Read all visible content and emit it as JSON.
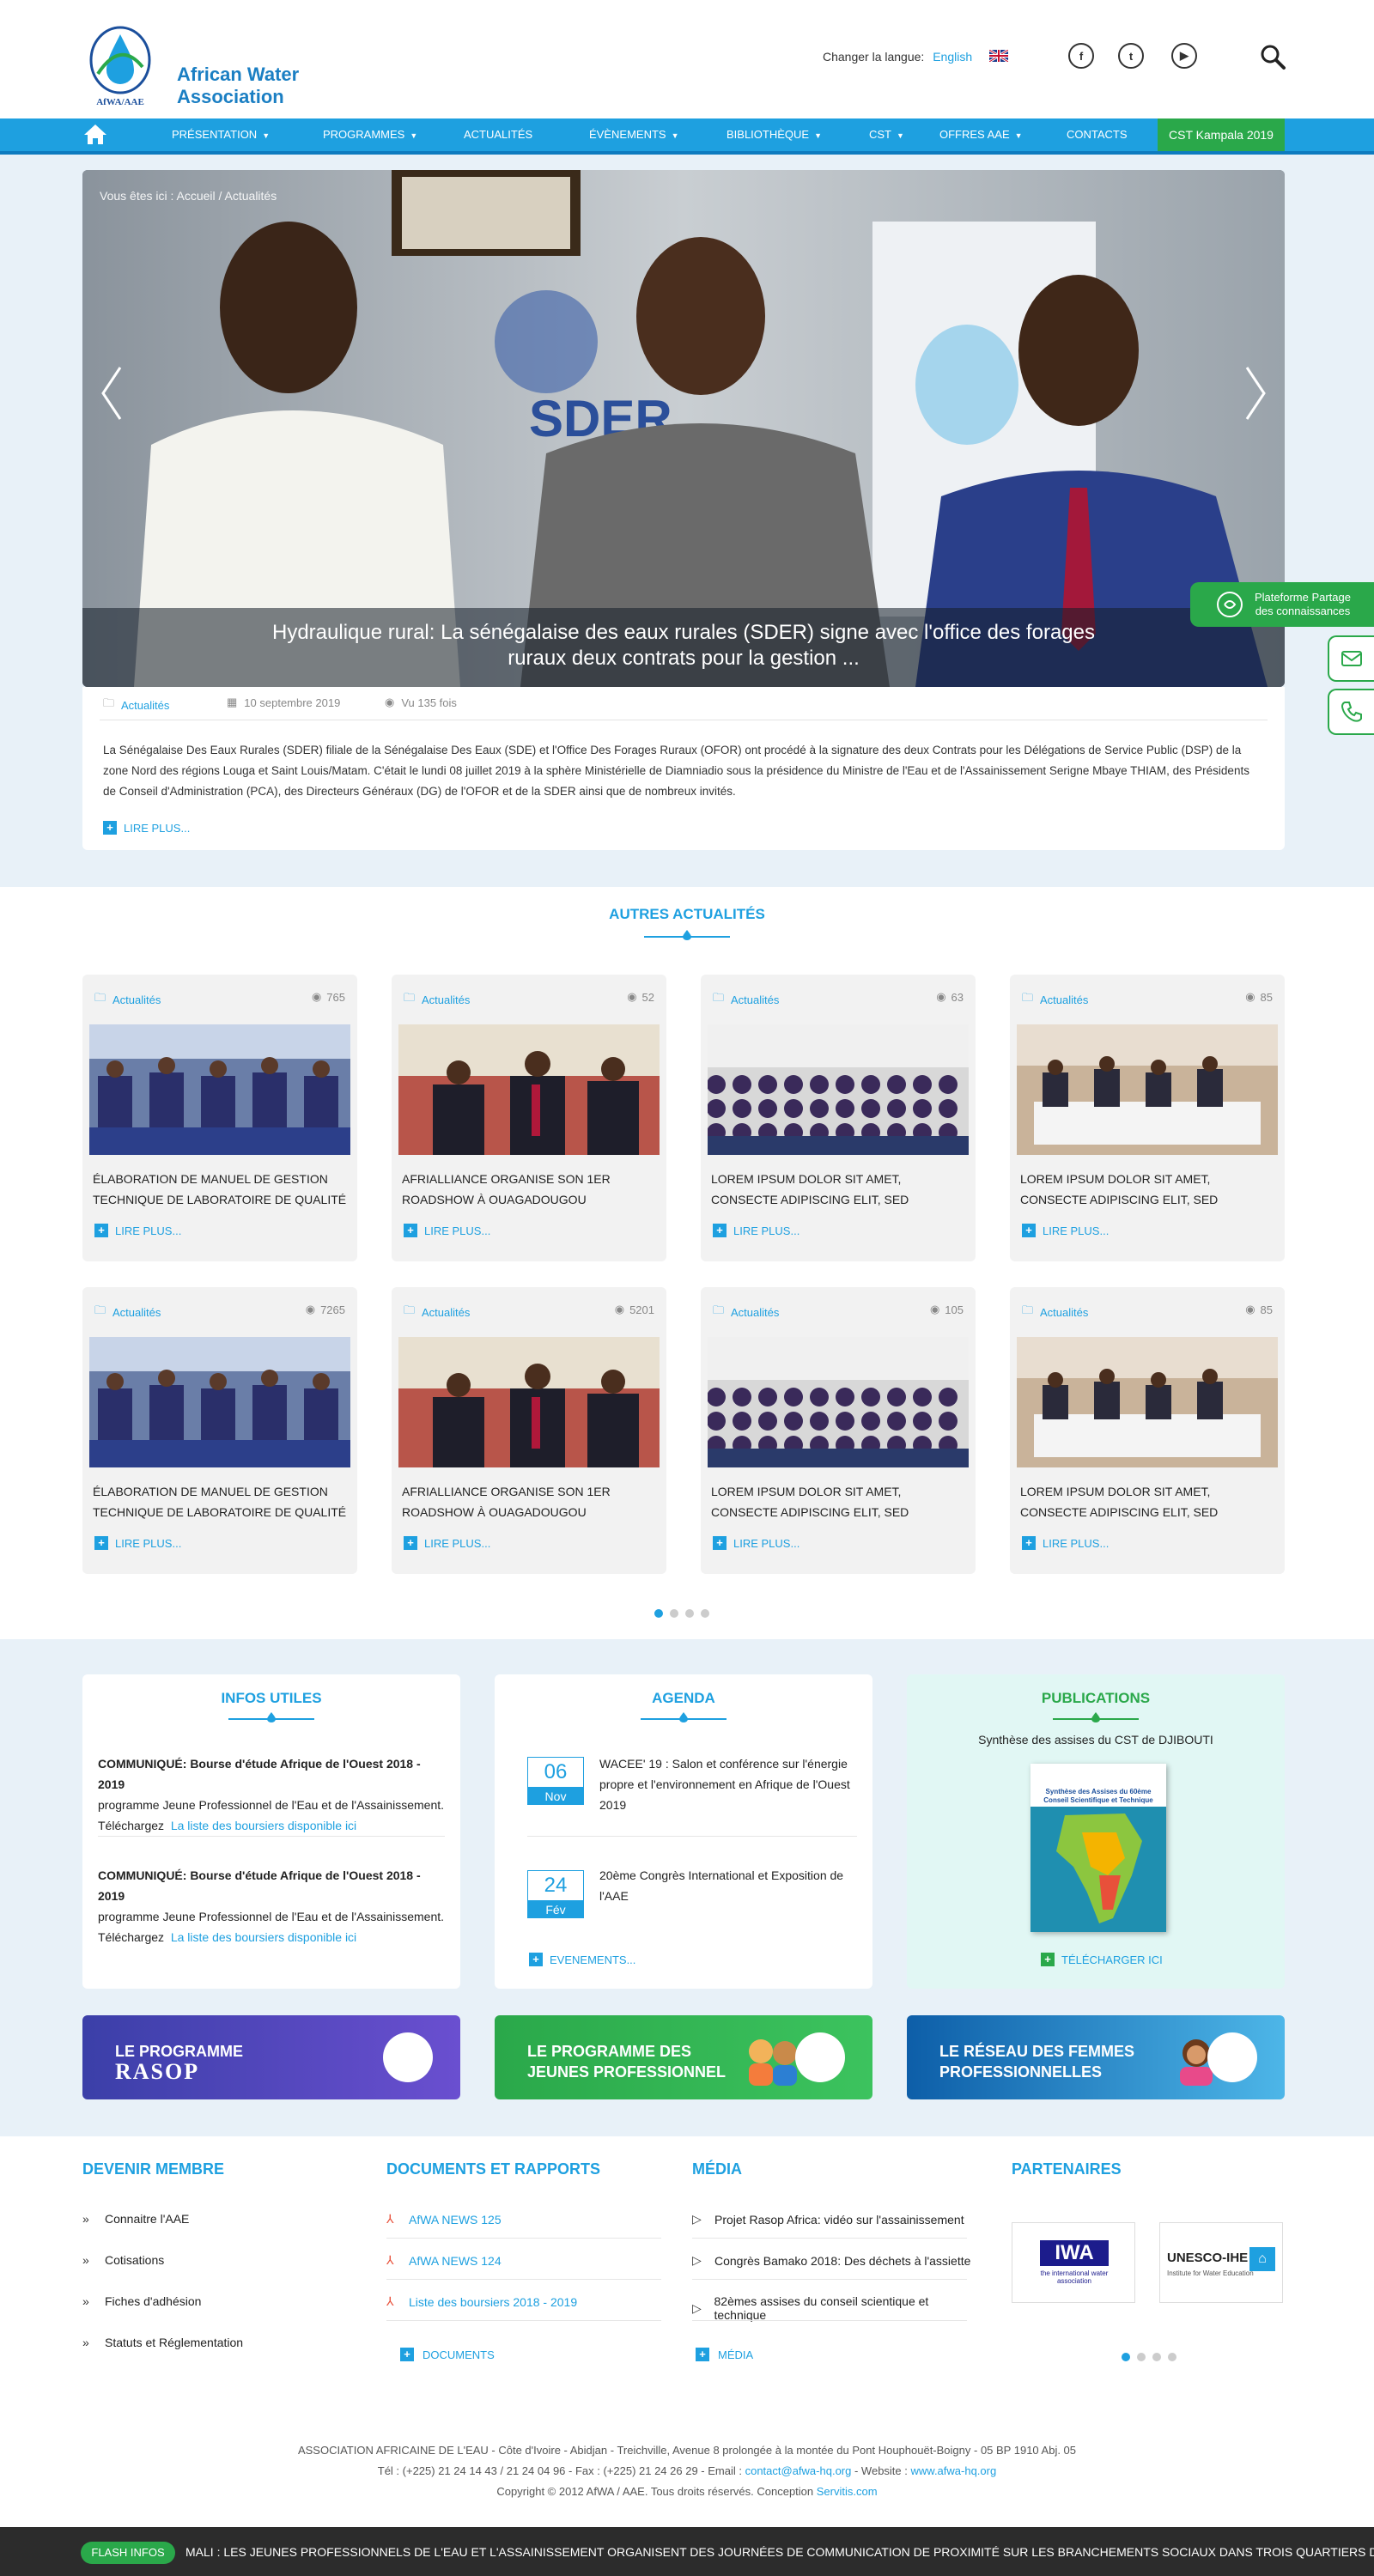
{
  "header": {
    "logo_line1": "African Water",
    "logo_line2": "Association",
    "logo_mark": "AfWA / AAE",
    "lang_label": "Changer la langue:",
    "lang_value": "English",
    "social": [
      "facebook-icon",
      "twitter-icon",
      "youtube-icon"
    ]
  },
  "nav": {
    "items": [
      {
        "label": "Présentation",
        "caret": true
      },
      {
        "label": "Programmes",
        "caret": true
      },
      {
        "label": "Actualités",
        "caret": false
      },
      {
        "label": "Évènements",
        "caret": true
      },
      {
        "label": "Bibliothèque",
        "caret": true
      },
      {
        "label": "CST",
        "caret": true
      },
      {
        "label": "Offres AAE",
        "caret": true
      },
      {
        "label": "Contacts",
        "caret": false
      }
    ],
    "cta": "CST Kampala 2019"
  },
  "hero": {
    "breadcrumb": "Vous êtes ici : Accueil / Actualités",
    "caption": "Hydraulique rural: La sénégalaise des eaux rurales (SDER) signe avec l'office des forages ruraux deux contrats pour la gestion ...",
    "category": "Actualités",
    "date": "10 septembre 2019",
    "views": "Vu 135 fois",
    "paragraph": "La Sénégalaise Des Eaux Rurales (SDER) filiale de la Sénégalaise Des Eaux (SDE) et l'Office Des Forages Ruraux (OFOR) ont procédé à la signature des deux Contrats pour les Délégations de Service Public (DSP) de la zone Nord des régions Louga et Saint Louis/Matam. C'était le lundi 08 juillet 2019 à la sphère Ministérielle de Diamniadio sous la présidence du Ministre de l'Eau et de l'Assainissement Serigne Mbaye THIAM, des Présidents de Conseil d'Administration (PCA), des Directeurs Généraux (DG) de l'OFOR et de la SDER ainsi que de nombreux invités.",
    "read_more": "LIRE PLUS..."
  },
  "side_widget": {
    "label1": "Plateforme Partage",
    "label2": "des connaissances"
  },
  "news": {
    "title": "AUTRES ACTUALITÉS",
    "read_more": "LIRE PLUS...",
    "cards": [
      {
        "cat": "Actualités",
        "views": "765",
        "title": "ÉLABORATION DE MANUEL DE GESTION TECHNIQUE DE LABORATOIRE DE QUALITÉ",
        "img": "meeting-photo"
      },
      {
        "cat": "Actualités",
        "views": "52",
        "title": "AFRIALLIANCE ORGANISE SON 1er ROADSHOW à OUAGADOUGOU",
        "img": "officials-photo"
      },
      {
        "cat": "Actualités",
        "views": "63",
        "title": "LOREM IPSUM DOLOR SIT AMET, CONSECTE ADIPISCING ELIT, SED",
        "img": "crowd-photo"
      },
      {
        "cat": "Actualités",
        "views": "85",
        "title": "LOREM IPSUM DOLOR SIT AMET, CONSECTE ADIPISCING ELIT, SED",
        "img": "conference-photo"
      },
      {
        "cat": "Actualités",
        "views": "7265",
        "title": "ÉLABORATION DE MANUEL DE GESTION TECHNIQUE DE LABORATOIRE DE QUALITÉ",
        "img": "meeting-photo"
      },
      {
        "cat": "Actualités",
        "views": "5201",
        "title": "AFRIALLIANCE ORGANISE SON 1er ROADSHOW à OUAGADOUGOU",
        "img": "officials-photo"
      },
      {
        "cat": "Actualités",
        "views": "105",
        "title": "LOREM IPSUM DOLOR SIT AMET, CONSECTE ADIPISCING ELIT, SED",
        "img": "crowd-photo"
      },
      {
        "cat": "Actualités",
        "views": "85",
        "title": "LOREM IPSUM DOLOR SIT AMET, CONSECTE ADIPISCING ELIT, SED",
        "img": "conference-photo"
      }
    ]
  },
  "infos": {
    "title": "INFOS UTILES",
    "items": [
      {
        "bold": "COMMUNIQUÉ: Bourse d'étude Afrique de l'Ouest 2018 - 2019",
        "text": "programme Jeune Professionnel de l'Eau et de l'Assainissement.",
        "prefix": "Téléchargez",
        "link": "La liste des boursiers disponible ici"
      },
      {
        "bold": "COMMUNIQUÉ: Bourse d'étude Afrique de l'Ouest 2018 - 2019",
        "text": "programme Jeune Professionnel de l'Eau et de l'Assainissement.",
        "prefix": "Téléchargez",
        "link": "La liste des boursiers disponible ici"
      }
    ]
  },
  "agenda": {
    "title": "AGENDA",
    "events": [
      {
        "day": "06",
        "month": "Nov",
        "text": "WACEE' 19 : Salon et conférence sur l'énergie propre et l'environnement en Afrique de l'Ouest 2019"
      },
      {
        "day": "24",
        "month": "Fév",
        "text": "20ème Congrès International et Exposition de l'AAE"
      }
    ],
    "more": "EVENEMENTS..."
  },
  "publications": {
    "title": "PUBLICATIONS",
    "subtitle": "Synthèse des assises du CST de DJIBOUTI",
    "cover_title": "Synthèse des Assises du 60ème Conseil Scientifique et Technique",
    "download": "TÉLÉCHARGER ICI"
  },
  "banners": [
    {
      "line1": "LE PROGRAMME",
      "line2": "RASOP",
      "color1": "#3b3fa8",
      "color2": "#6a4fd0"
    },
    {
      "line1": "LE PROGRAMME DES",
      "line2": "JEUNES PROFESSIONNEL",
      "color1": "#2aa84a",
      "color2": "#3cc35e"
    },
    {
      "line1": "LE RÉSEAU DES FEMMES",
      "line2": "PROFESSIONNELLES",
      "color1": "#0d5ea8",
      "color2": "#4db6e8"
    }
  ],
  "footer": {
    "membre": {
      "title": "DEVENIR MEMBRE",
      "items": [
        "Connaitre l'AAE",
        "Cotisations",
        "Fiches d'adhésion",
        "Statuts et Réglementation"
      ]
    },
    "docs": {
      "title": "DOCUMENTS ET RAPPORTS",
      "items": [
        "AfWA NEWS 125",
        "AfWA NEWS 124",
        "Liste des boursiers 2018 - 2019"
      ],
      "more": "DOCUMENTS"
    },
    "media": {
      "title": "MÉDIA",
      "items": [
        "Projet Rasop Africa: vidéo sur l'assainissement",
        "Congrès Bamako 2018: Des déchets à l'assiette",
        "82èmes assises du conseil scientique et technique"
      ],
      "more": "MÉDIA"
    },
    "partners": {
      "title": "PARTENAIRES",
      "p1_a": "IWA",
      "p1_b": "the international water association",
      "p2_a": "UNESCO-IHE",
      "p2_b": "Institute for Water Education"
    },
    "address": "ASSOCIATION AFRICAINE DE L'EAU - Côte d'Ivoire - Abidjan - Treichville, Avenue 8 prolongée à la montée du Pont Houphouët-Boigny - 05 BP 1910 Abj. 05",
    "tel": "Tél : (+225) 21 24 14 43 / 21 24 04 96 - Fax : (+225) 21 24 26 29 - Email :",
    "email": "contact@afwa-hq.org",
    "site_label": "- Website :",
    "site": "www.afwa-hq.org",
    "copyright": "Copyright © 2012 AfWA / AAE. Tous droits réservés. Conception",
    "designer": "Servitis.com"
  },
  "flash": {
    "badge": "FLASH INFOS",
    "text": "MALI : LES JEUNES PROFESSIONNELS DE L'EAU ET L'ASSAINISSEMENT ORGANISENT DES JOURNÉES DE COMMUNICATION DE PROXIMITÉ SUR LES BRANCHEMENTS SOCIAUX DANS TROIS QUARTIERS DU DISTRICT DE BAMAKO"
  },
  "colors": {
    "primary": "#1ea0e0",
    "green": "#2aa84a",
    "dark": "#2c2c2c"
  }
}
